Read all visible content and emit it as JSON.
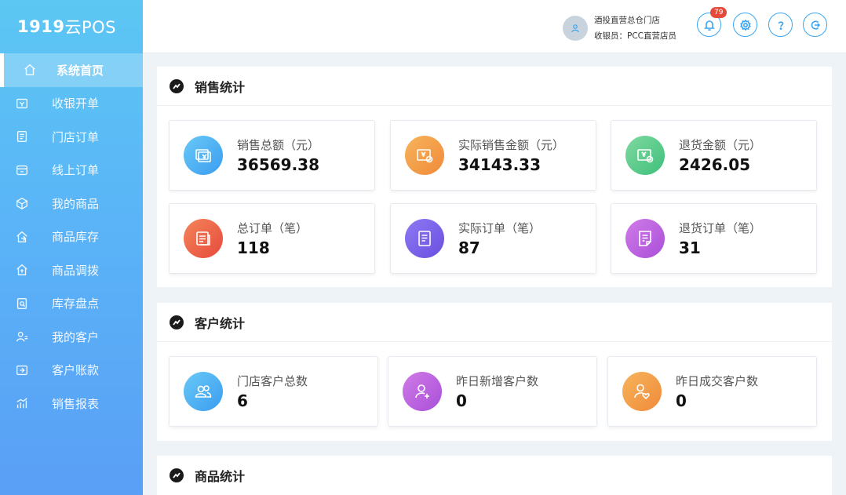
{
  "app": {
    "logo_bold": "1919",
    "logo_light": "云POS"
  },
  "sidebar": {
    "items": [
      {
        "label": "系统首页",
        "icon": "home-icon",
        "active": true
      },
      {
        "label": "收银开单",
        "icon": "cashier-icon"
      },
      {
        "label": "门店订单",
        "icon": "store-order-icon"
      },
      {
        "label": "线上订单",
        "icon": "online-order-icon"
      },
      {
        "label": "我的商品",
        "icon": "box-icon"
      },
      {
        "label": "商品库存",
        "icon": "inventory-icon"
      },
      {
        "label": "商品调拨",
        "icon": "transfer-icon"
      },
      {
        "label": "库存盘点",
        "icon": "stocktake-icon"
      },
      {
        "label": "我的客户",
        "icon": "customer-icon"
      },
      {
        "label": "客户账款",
        "icon": "account-icon"
      },
      {
        "label": "销售报表",
        "icon": "report-icon"
      }
    ]
  },
  "header": {
    "store": "酒投直营总仓门店",
    "cashier": "收银员：PCC直营店员",
    "notification_count": "79",
    "buttons": [
      "bell-icon",
      "gear-icon",
      "help-icon",
      "logout-icon"
    ]
  },
  "sales": {
    "title": "销售统计",
    "cards": [
      {
        "label": "销售总额（元）",
        "value": "36569.38",
        "icon": "cash-icon",
        "color": "#3b9cf0"
      },
      {
        "label": "实际销售金额（元）",
        "value": "34143.33",
        "icon": "cash-check-icon",
        "color": "#f08a3a"
      },
      {
        "label": "退货金额（元）",
        "value": "2426.05",
        "icon": "cash-minus-icon",
        "color": "#3fbf7b"
      },
      {
        "label": "总订单（笔）",
        "value": "118",
        "icon": "orders-icon",
        "color": "#e64a3b"
      },
      {
        "label": "实际订单（笔）",
        "value": "87",
        "icon": "document-icon",
        "color": "#6a4fe0"
      },
      {
        "label": "退货订单（笔）",
        "value": "31",
        "icon": "return-doc-icon",
        "color": "#a94fd8"
      }
    ]
  },
  "customers": {
    "title": "客户统计",
    "cards": [
      {
        "label": "门店客户总数",
        "value": "6",
        "icon": "users-icon",
        "color": "#3b9cf0"
      },
      {
        "label": "昨日新增客户数",
        "value": "0",
        "icon": "user-plus-icon",
        "color": "#a94fd8"
      },
      {
        "label": "昨日成交客户数",
        "value": "0",
        "icon": "user-heart-icon",
        "color": "#f08a3a"
      }
    ]
  },
  "products": {
    "title": "商品统计"
  }
}
